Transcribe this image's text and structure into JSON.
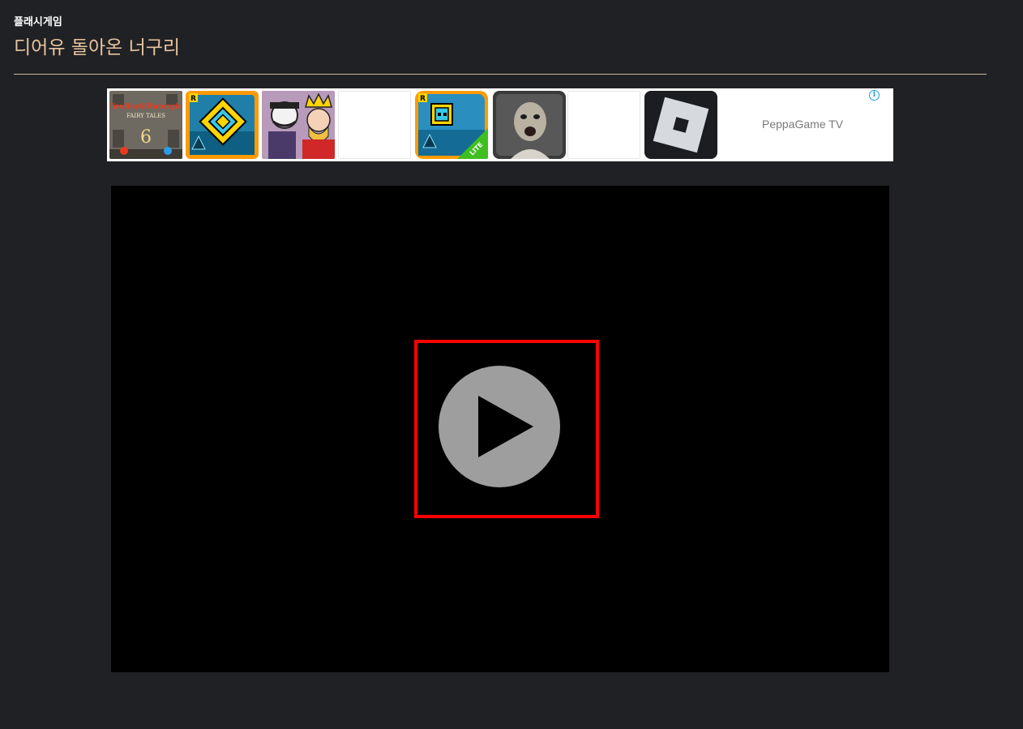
{
  "header": {
    "category": "플래시게임",
    "title": "디어유 돌아온 너구리"
  },
  "ad": {
    "label": "PeppaGame TV",
    "info_icon": "info-icon",
    "tiles": [
      {
        "name": "fireboy-watergirl-tile",
        "text_lines": [
          "FireBoy&Watergirl",
          "FAIRY TALES",
          "6"
        ]
      },
      {
        "name": "geometry-dash-tile",
        "badge": "R"
      },
      {
        "name": "cartoon-king-tile"
      },
      {
        "name": "blank-tile"
      },
      {
        "name": "geometry-dash-lite-tile",
        "badge": "R",
        "ribbon": "LITE"
      },
      {
        "name": "granny-tile"
      },
      {
        "name": "blank-tile"
      },
      {
        "name": "roblox-tile"
      }
    ],
    "colors": {
      "geometry_orange": "#ff9b00",
      "geometry_cyan": "#38c8e8",
      "geometry_yellow": "#ffd400",
      "lite_green": "#3fbf1f",
      "info_blue": "#1aa1d6"
    }
  },
  "game": {
    "play_icon": "play-icon",
    "play_circle_color": "#9e9e9e",
    "highlight_color": "#ff0000"
  }
}
